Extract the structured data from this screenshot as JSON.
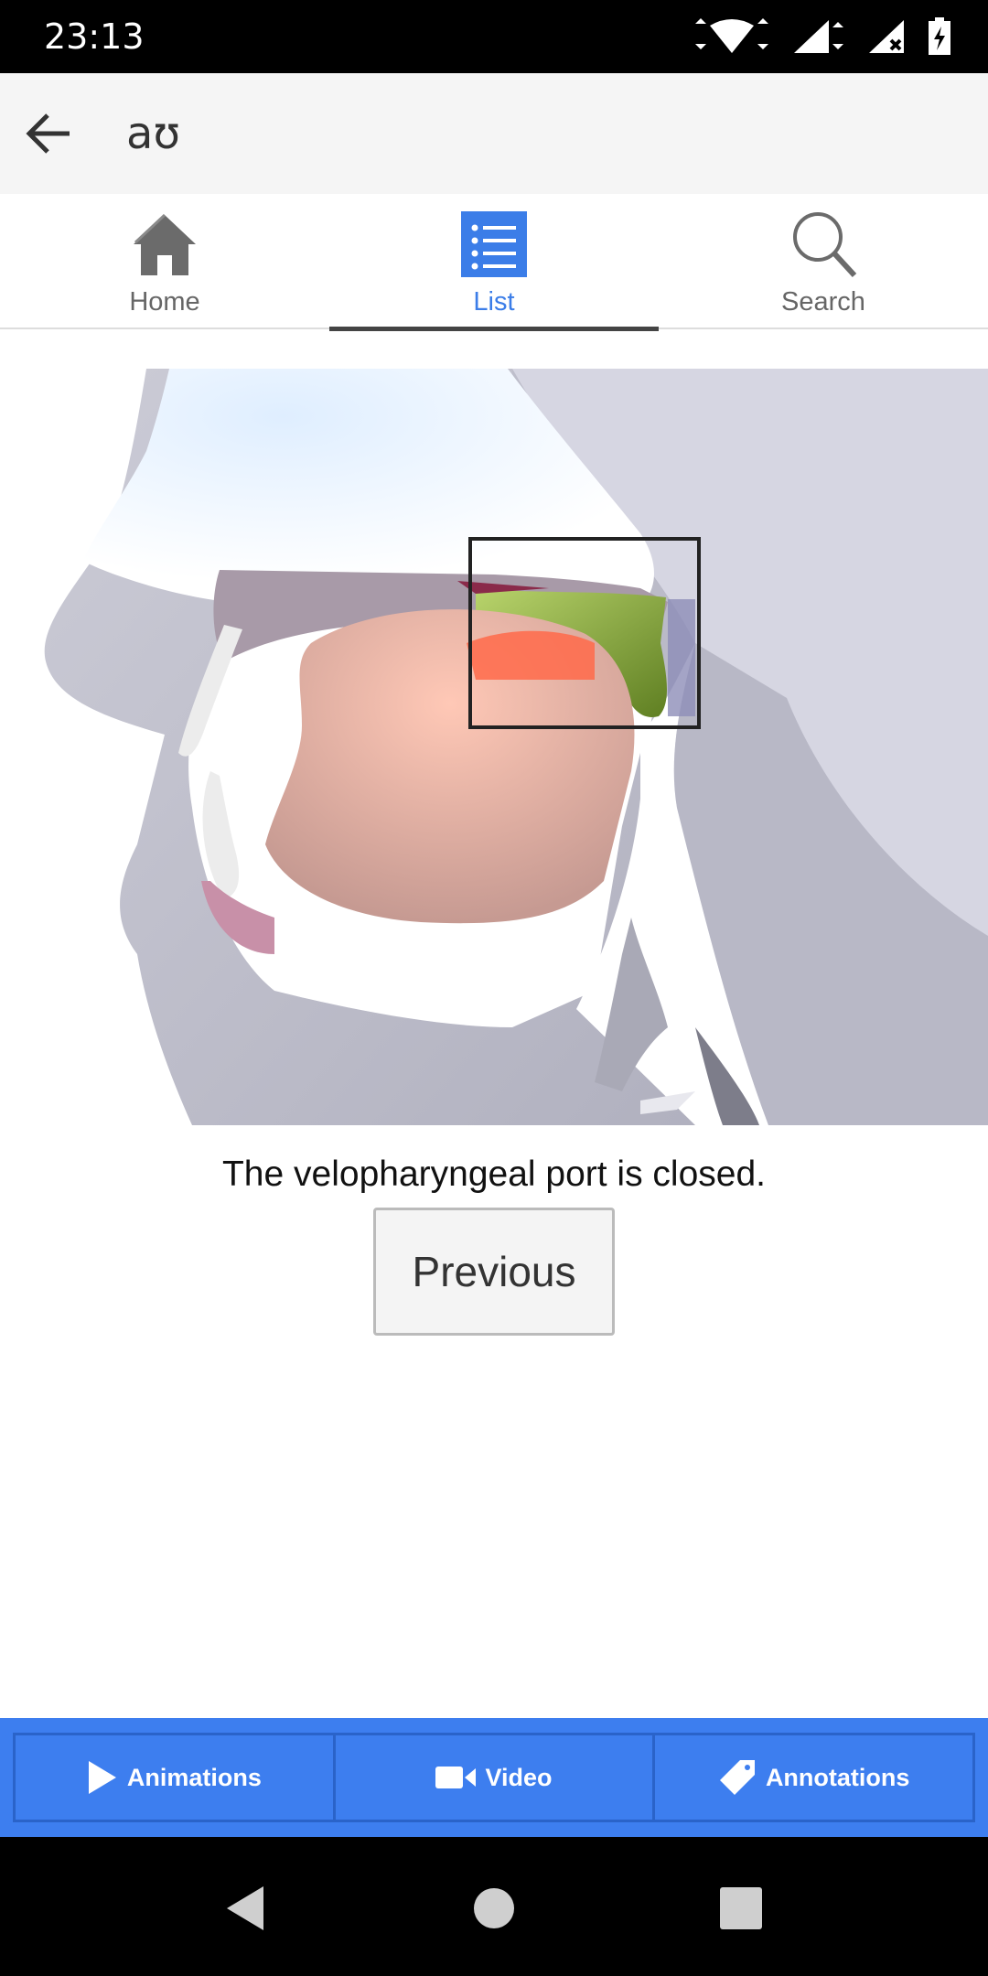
{
  "status_bar": {
    "time": "23:13"
  },
  "app_bar": {
    "title": "aʊ"
  },
  "tabs": [
    {
      "label": "Home",
      "icon": "home-icon",
      "active": false
    },
    {
      "label": "List",
      "icon": "list-icon",
      "active": true
    },
    {
      "label": "Search",
      "icon": "search-icon",
      "active": false
    }
  ],
  "main": {
    "caption": "The velopharyngeal port is closed.",
    "previous_label": "Previous"
  },
  "bottom_bar": {
    "animations_label": "Animations",
    "video_label": "Video",
    "annotations_label": "Annotations"
  },
  "colors": {
    "accent": "#3b7de8",
    "bottom_bar": "#3d7eef",
    "status_bar": "#000000"
  }
}
